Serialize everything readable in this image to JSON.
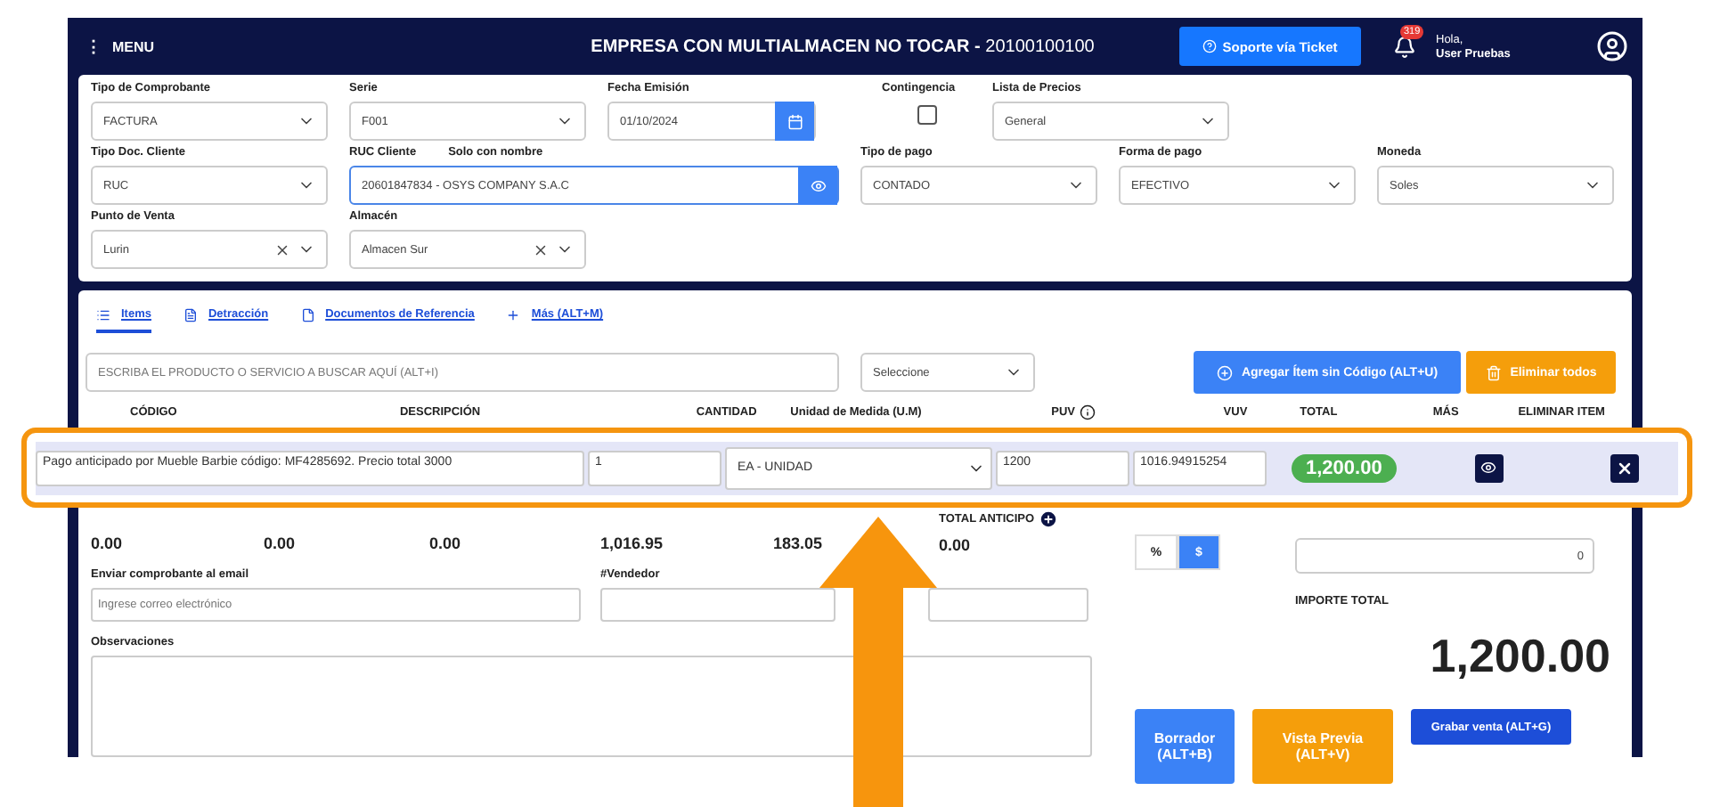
{
  "header": {
    "menu_icon": "⋮",
    "menu_label": "MENU",
    "company": "**EMPRESA CON MULTIALMACEN NO TOCAR -** 20100100100",
    "support_button": "Soporte vía Ticket",
    "notification_count": "319",
    "greeting": "Hola,",
    "user": "User Pruebas"
  },
  "form": {
    "first_line": [
      {
        "kind": "select",
        "label": "Tipo de Comprobante",
        "value": "FACTURA"
      },
      {
        "kind": "select",
        "label": "Serie",
        "value": "F001"
      },
      {
        "kind": "date",
        "label": "Fecha Emisión",
        "value": "01/10/2024"
      },
      {
        "kind": "checkbox",
        "label": "Contingencia",
        "checked": false
      },
      {
        "kind": "select",
        "label": "Lista de Precios",
        "value": "General"
      }
    ],
    "second_line": [
      {
        "kind": "select",
        "label": "Tipo Doc. Cliente",
        "value": "RUC"
      },
      {
        "kind": "search",
        "label": "RUC Cliente",
        "extra_label": "Solo con nombre",
        "value": "20601847834 - OSYS COMPANY S.A.C"
      },
      {
        "kind": "select",
        "label": "Tipo de pago",
        "value": "CONTADO"
      },
      {
        "kind": "select",
        "label": "Forma de pago",
        "value": "EFECTIVO"
      },
      {
        "kind": "select",
        "label": "Moneda",
        "value": "Soles"
      }
    ],
    "third_line": [
      {
        "kind": "clearable",
        "label": "Punto de Venta",
        "value": "Lurin"
      },
      {
        "kind": "clearable",
        "label": "Almacén",
        "value": "Almacen Sur"
      }
    ]
  },
  "tabs": [
    {
      "label": "Items",
      "selected": true
    },
    {
      "label": "Detracción",
      "selected": false
    },
    {
      "label": "Documentos de Referencia",
      "selected": false
    },
    {
      "label": "Más (ALT+M)",
      "selected": false
    }
  ],
  "product_search": {
    "placeholder": "ESCRIBA EL PRODUCTO O SERVICIO A BUSCAR AQUÍ (ALT+I)"
  },
  "filter_select": {
    "value": "Seleccione"
  },
  "add_button": "Agregar Ítem sin Código (ALT+U)",
  "delete_all_button": "Eliminar todos",
  "table": {
    "columns": [
      "CÓDIGO",
      "DESCRIPCIÓN",
      "CANTIDAD",
      "Unidad de Medida (U.M)",
      "PUV",
      "VUV",
      "TOTAL",
      "MÁS",
      "ELIMINAR ITEM"
    ],
    "row": {
      "description": "Pago anticipado por Mueble Barbie código: MF4285692. Precio total 3000",
      "quantity": "1",
      "unit": "EA - UNIDAD",
      "puv": "1200",
      "vuv": "1016.94915254",
      "total": "1,200.00"
    }
  },
  "totals": [
    "0.00",
    "0.00",
    "0.00",
    "1,016.95",
    "183.05"
  ],
  "advance": {
    "label": "TOTAL ANTICIPO",
    "value": "0.00"
  },
  "discount": {
    "options": [
      {
        "label": "%",
        "selected": false
      },
      {
        "label": "$",
        "selected": true
      }
    ],
    "value": "0"
  },
  "email": {
    "label": "Enviar comprobante al email",
    "placeholder": "Ingrese correo electrónico"
  },
  "seller": {
    "label": "#Vendedor"
  },
  "notes": {
    "label": "Observaciones"
  },
  "total": {
    "label": "IMPORTE TOTAL",
    "value": "1,200.00"
  },
  "buttons": [
    {
      "kind": "draft",
      "label": "Borrador",
      "shortcut": "(ALT+B)"
    },
    {
      "kind": "preview",
      "label": "Vista Previa",
      "shortcut": "(ALT+V)"
    },
    {
      "kind": "save",
      "label": "Grabar venta (ALT+G)"
    }
  ]
}
